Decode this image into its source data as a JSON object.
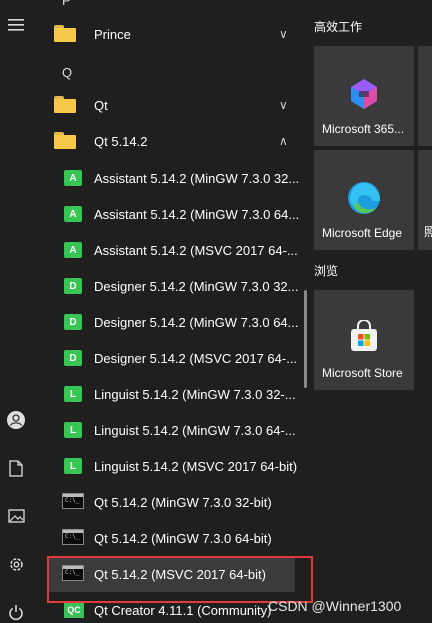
{
  "rail": {
    "icons": [
      "hamburger-menu-icon",
      "user-icon",
      "document-icon",
      "pictures-icon",
      "settings-gear-icon",
      "power-icon"
    ]
  },
  "list": {
    "letter_p": "P",
    "prince": {
      "label": "Prince",
      "chevron": "∨"
    },
    "letter_q": "Q",
    "qt": {
      "label": "Qt",
      "chevron": "∨"
    },
    "qt5142": {
      "label": "Qt 5.14.2",
      "chevron": "∧"
    },
    "items": [
      {
        "badge": "A",
        "label": "Assistant 5.14.2 (MinGW 7.3.0 32..."
      },
      {
        "badge": "A",
        "label": "Assistant 5.14.2 (MinGW 7.3.0 64..."
      },
      {
        "badge": "A",
        "label": "Assistant 5.14.2 (MSVC 2017 64-..."
      },
      {
        "badge": "D",
        "label": "Designer 5.14.2 (MinGW 7.3.0 32..."
      },
      {
        "badge": "D",
        "label": "Designer 5.14.2 (MinGW 7.3.0 64..."
      },
      {
        "badge": "D",
        "label": "Designer 5.14.2 (MSVC 2017 64-..."
      },
      {
        "badge": "L",
        "label": "Linguist 5.14.2 (MinGW 7.3.0 32-..."
      },
      {
        "badge": "L",
        "label": "Linguist 5.14.2 (MinGW 7.3.0 64-..."
      },
      {
        "badge": "L",
        "label": "Linguist 5.14.2 (MSVC 2017 64-bit)"
      }
    ],
    "consoles": [
      {
        "label": "Qt 5.14.2 (MinGW 7.3.0 32-bit)"
      },
      {
        "label": "Qt 5.14.2 (MinGW 7.3.0 64-bit)"
      },
      {
        "label": "Qt 5.14.2 (MSVC 2017 64-bit)"
      }
    ],
    "creator": {
      "badge": "QC",
      "label": "Qt Creator 4.11.1 (Community)"
    }
  },
  "tiles": {
    "group1_title": "高效工作",
    "group2_title": "浏览",
    "m365": "Microsoft 365...",
    "edge": "Microsoft Edge",
    "edge_partial": "照",
    "store": "Microsoft Store"
  },
  "watermark": "CSDN @Winner1300"
}
